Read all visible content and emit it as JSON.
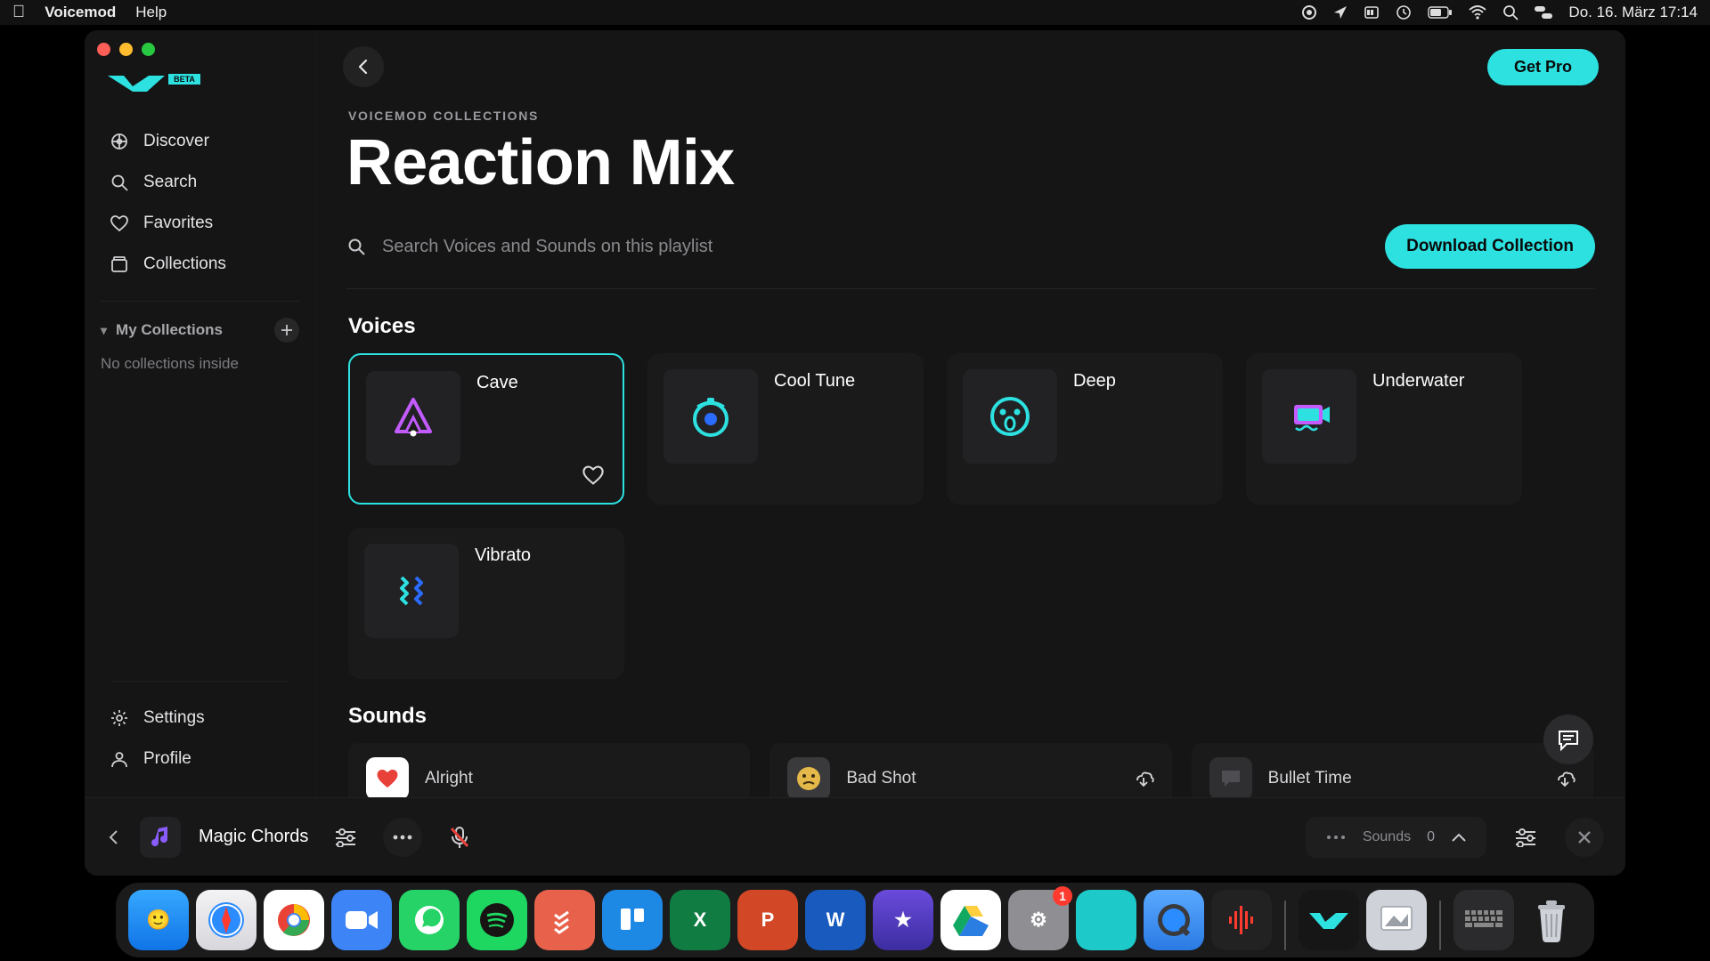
{
  "menubar": {
    "app": "Voicemod",
    "help": "Help",
    "datetime": "Do. 16. März  17:14"
  },
  "sidebar": {
    "logo_badge": "BETA",
    "items": [
      {
        "label": "Discover"
      },
      {
        "label": "Search"
      },
      {
        "label": "Favorites"
      },
      {
        "label": "Collections"
      }
    ],
    "my_collections_label": "My Collections",
    "my_collections_empty": "No collections inside",
    "bottom": [
      {
        "label": "Settings"
      },
      {
        "label": "Profile"
      }
    ]
  },
  "header": {
    "breadcrumb": "VOICEMOD COLLECTIONS",
    "title": "Reaction Mix",
    "getpro": "Get Pro",
    "search_placeholder": "Search Voices and Sounds on this playlist",
    "download": "Download Collection"
  },
  "voices_heading": "Voices",
  "voices": [
    {
      "name": "Cave",
      "selected": true,
      "icon": "cave"
    },
    {
      "name": "Cool Tune",
      "icon": "cooltune"
    },
    {
      "name": "Deep",
      "icon": "deep"
    },
    {
      "name": "Underwater",
      "icon": "underwater"
    },
    {
      "name": "Vibrato",
      "icon": "vibrato"
    }
  ],
  "sounds_heading": "Sounds",
  "sounds": [
    {
      "name": "Alright",
      "thumb": "heart"
    },
    {
      "name": "Bad Shot",
      "thumb": "emoji"
    },
    {
      "name": "Bullet Time",
      "thumb": "dark"
    }
  ],
  "bottombar": {
    "current_voice": "Magic Chords",
    "sounds_label": "Sounds",
    "sounds_count": "0"
  },
  "dock": {
    "settings_badge": "1"
  },
  "colors": {
    "accent": "#2de1e1",
    "bg": "#151516",
    "card": "#1a1a1b"
  }
}
